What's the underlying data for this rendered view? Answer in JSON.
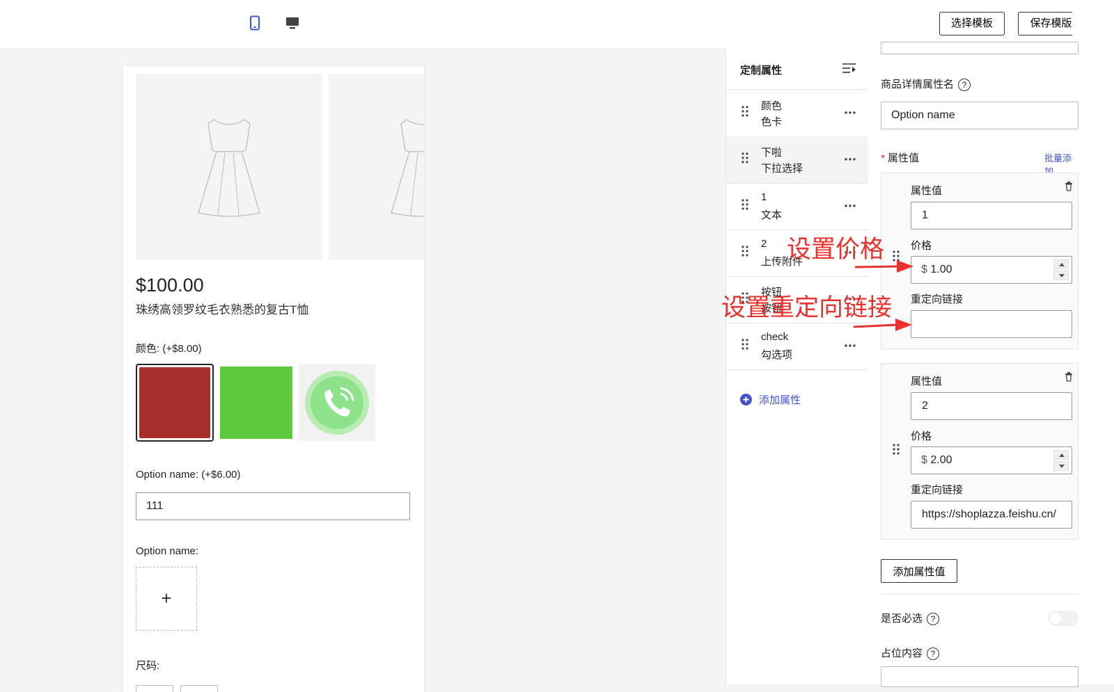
{
  "toolbar": {
    "device_mobile_icon": "mobile-icon",
    "device_desktop_icon": "desktop-icon",
    "select_template": "选择模板",
    "save_template": "保存模版"
  },
  "preview": {
    "price": "$100.00",
    "title": "珠绣高领罗纹毛衣熟悉的复古T恤",
    "color_label": "颜色:",
    "color_extra": "(+$8.00)",
    "swatches": [
      {
        "color": "#a8302a",
        "selected": true
      },
      {
        "color": "#5dca3c",
        "selected": false
      },
      {
        "type": "image",
        "icon": "phone-call-icon"
      }
    ],
    "option1_label": "Option name:",
    "option1_extra": "(+$6.00)",
    "option1_value": "111",
    "option2_label": "Option name:",
    "upload_plus": "+",
    "size_label": "尺码:"
  },
  "attr_panel": {
    "title": "定制属性",
    "items": [
      {
        "name": "颜色",
        "type": "色卡"
      },
      {
        "name": "下啦",
        "type": "下拉选择"
      },
      {
        "name": "1",
        "type": "文本"
      },
      {
        "name": "2",
        "type": "上传附件"
      },
      {
        "name": "按钮",
        "type": "按钮"
      },
      {
        "name": "check",
        "type": "勾选项"
      }
    ],
    "add_label": "添加属性"
  },
  "settings": {
    "detail_attr_label": "商品详情属性名",
    "detail_attr_value": "Option name",
    "values_label": "属性值",
    "required_mark": "*",
    "batch_add": "批量添加",
    "values": [
      {
        "value_label": "属性值",
        "value": "1",
        "price_label": "价格",
        "currency": "$",
        "price": "1.00",
        "link_label": "重定向链接",
        "link": ""
      },
      {
        "value_label": "属性值",
        "value": "2",
        "price_label": "价格",
        "currency": "$",
        "price": "2.00",
        "link_label": "重定向链接",
        "link": "https://shoplazza.feishu.cn/"
      }
    ],
    "add_value": "添加属性值",
    "required_label": "是否必选",
    "placeholder_label": "占位内容"
  },
  "annotations": {
    "set_price": "设置价格",
    "set_redirect": "设置重定向链接"
  },
  "colors": {
    "accent": "#4353c8",
    "annotation": "#e8322e"
  }
}
